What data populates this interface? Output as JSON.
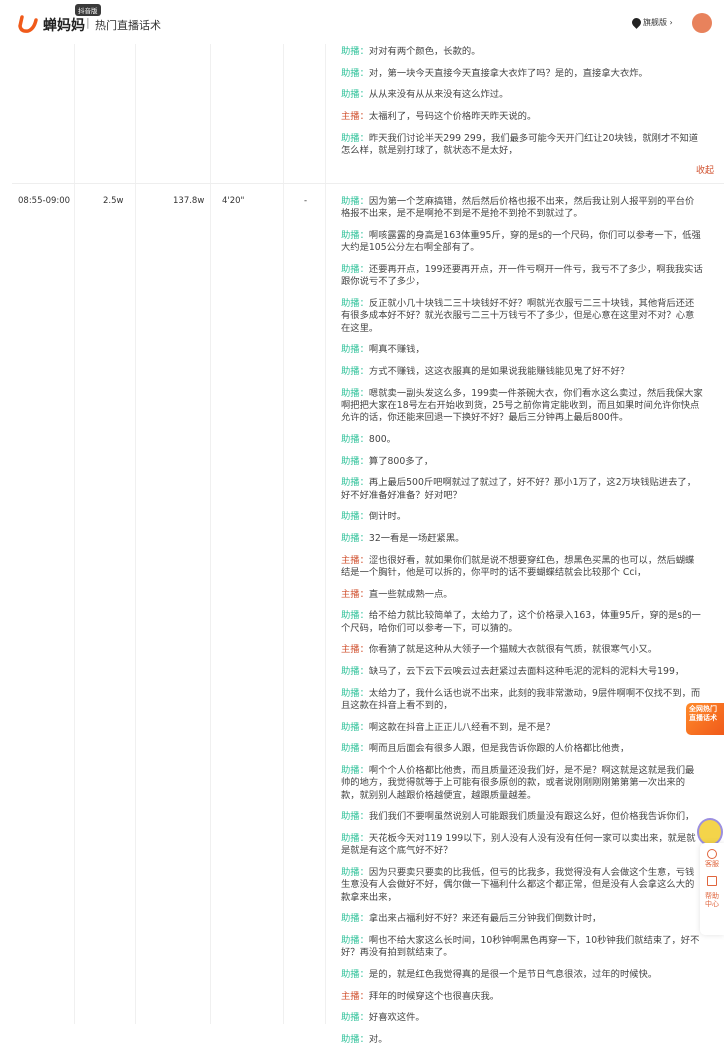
{
  "header": {
    "badge": "抖音版",
    "brand": "蝉妈妈",
    "separator": "|",
    "title": "热门直播话术",
    "vip_label": "旗舰版 ›"
  },
  "rows": [
    {
      "collapse_label": "收起",
      "messages": [
        {
          "role": "助播",
          "text": "对对有两个颜色，长款的。"
        },
        {
          "role": "助播",
          "text": "对，第一块今天直接今天直接拿大衣炸了吗？是的，直接拿大衣炸。"
        },
        {
          "role": "助播",
          "text": "从从来没有从从来没有这么炸过。"
        },
        {
          "role": "主播",
          "text": "太福利了，号码这个价格昨天昨天说的。"
        },
        {
          "role": "助播",
          "text": "昨天我们讨论半天299 299，我们最多可能今天开门红让20块钱，就刚才不知道怎么样，就是别打球了，就状态不是太好，"
        }
      ]
    },
    {
      "time": "08:55-09:00",
      "col2": "2.5w",
      "col3": "137.8w",
      "col4": "4'20\"",
      "col5": "-",
      "messages": [
        {
          "role": "助播",
          "text": "因为第一个芝麻搞错，然后然后价格也报不出来，然后我让别人报平别的平台价格报不出来，是不是啊抢不到是不是抢不到抢不到就过了。"
        },
        {
          "role": "助播",
          "text": "啊咳露露的身高是163体重95斤，穿的是s的一个尺码，你们可以参考一下，低强大约是105公分左右啊全部有了。"
        },
        {
          "role": "助播",
          "text": "还要再开点，199还要再开点，开一件亏啊开一件亏，我亏不了多少，啊我我实话跟你说亏不了多少，"
        },
        {
          "role": "助播",
          "text": "反正就小几十块钱二三十块钱好不好？啊就光衣服亏二三十块钱，其他背后还还有很多成本好不好？就光衣服亏二三十万钱亏不了多少，但是心意在这里对不对？心意在这里。"
        },
        {
          "role": "助播",
          "text": "啊真不赚钱，"
        },
        {
          "role": "助播",
          "text": "方式不赚钱，这这衣服真的是如果说我能赚钱能见鬼了好不好？"
        },
        {
          "role": "助播",
          "text": "嗯就卖一副头发这么多，199卖一件茶碗大衣，你们看水这么卖过，然后我保大家啊把把大家在18号左右开始收到货，25号之前你肯定能收到，而且如果时间允许你快点允许的话，你还能来回退一下换好不好？最后三分钟再上最后800件。"
        },
        {
          "role": "助播",
          "text": "800。"
        },
        {
          "role": "助播",
          "text": "算了800多了，"
        },
        {
          "role": "助播",
          "text": "再上最后500斤吧啊就过了就过了，好不好？那小1万了，这2万块钱贴进去了，好不好准备好准备？好对吧？"
        },
        {
          "role": "助播",
          "text": "倒计时。"
        },
        {
          "role": "助播",
          "text": "32一看是一场赶紧黑。"
        },
        {
          "role": "主播",
          "text": "涩也很好看，就如果你们就是说不想要穿红色，想黑色买黑的也可以，然后蝴蝶结是一个胸针，他是可以拆的，你平时的话不要蝴蝶结就会比较那个 Cci，"
        },
        {
          "role": "主播",
          "text": "直一些就成熟一点。"
        },
        {
          "role": "助播",
          "text": "给不给力就比较简单了，太给力了，这个价格录入163，体重95斤，穿的是s的一个尺码，哈你们可以参考一下，可以猜的。"
        },
        {
          "role": "主播",
          "text": "你看猜了就是这种从大领子一个猫贼大衣就很有气质，就很寒气小又。"
        },
        {
          "role": "助播",
          "text": "缺马了，云下云下云唉云过去赶紧过去面料这种毛泥的泥料的泥料大号199，"
        },
        {
          "role": "助播",
          "text": "太给力了，我什么话也说不出来，此刻的我非常激动，9层件啊啊不仅找不到，而且这款在抖音上看不到的，"
        },
        {
          "role": "助播",
          "text": "啊这款在抖音上正正儿八经看不到，是不是？"
        },
        {
          "role": "助播",
          "text": "啊而且后面会有很多人跟，但是我告诉你跟的人价格都比他贵，"
        },
        {
          "role": "助播",
          "text": "啊个个人价格都比他贵，而且质量还没我们好，是不是？啊这就是这就是我们最帅的地方，我觉得就等于上可能有很多原创的款，或者说刚刚刚刚第第第一次出来的款，就别别人越跟价格越便宜，越跟质量越差。"
        },
        {
          "role": "助播",
          "text": "我们我们不要啊虽然说别人可能跟我们质量没有跟这么好，但价格我告诉你们，"
        },
        {
          "role": "助播",
          "text": "天花板今天对119 199以下，别人没有人没有没有任何一家可以卖出来，就是就是就是有这个底气好不好？"
        },
        {
          "role": "助播",
          "text": "因为只要卖只要卖的比我低，但亏的比我多，我觉得没有人会做这个生意，亏钱生意没有人会做好不好，偶尔做一下福利什么都这个都正常，但是没有人会拿这么大的款拿来出来，"
        },
        {
          "role": "助播",
          "text": "拿出来占福利好不好？来还有最后三分钟我们倒数计时，"
        },
        {
          "role": "助播",
          "text": "啊也不给大家这么长时间，10秒钟啊黑色再穿一下，10秒钟我们就结束了，好不好？再没有拍到就结束了。"
        },
        {
          "role": "助播",
          "text": "是的，就是红色我觉得真的是很一个是节日气息很浓，过年的时候快。"
        },
        {
          "role": "主播",
          "text": "拜年的时候穿这个也很喜庆我。"
        },
        {
          "role": "助播",
          "text": "好喜欢这件。"
        },
        {
          "role": "助播",
          "text": "对。"
        }
      ]
    }
  ],
  "promo": {
    "line1": "全网热门",
    "line2": "直播话术"
  },
  "side": {
    "service": "客服",
    "help": "帮助中心"
  },
  "colors": {
    "assistant": "#2fc29a",
    "host": "#d0502e",
    "brand": "#f05a1a"
  }
}
